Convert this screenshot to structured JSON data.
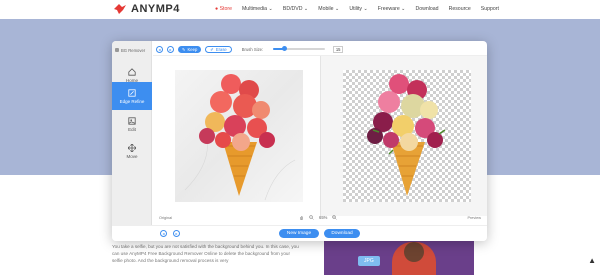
{
  "site": {
    "brand": "ANYMP4",
    "nav": [
      {
        "label": "Store",
        "hot": true
      },
      {
        "label": "Multimedia ⌄",
        "hot": false
      },
      {
        "label": "BD/DVD ⌄",
        "hot": false
      },
      {
        "label": "Mobile ⌄",
        "hot": false
      },
      {
        "label": "Utility ⌄",
        "hot": false
      },
      {
        "label": "Freeware ⌄",
        "hot": false
      },
      {
        "label": "Download",
        "hot": false
      },
      {
        "label": "Resource",
        "hot": false
      },
      {
        "label": "Support",
        "hot": false
      }
    ],
    "body_text": "You take a selfie, but you are not satisfied with the background behind you. In this case, you can use AnyMP4 Free Background Remover Online to delete the background from your selfie photo. And the background removal process is very",
    "image_badge": "JPG"
  },
  "editor": {
    "app_label": "BG Remover",
    "sidebar": [
      {
        "label": "Home",
        "icon": "home-icon",
        "active": false
      },
      {
        "label": "Edge Refine",
        "icon": "edge-refine-icon",
        "active": true
      },
      {
        "label": "Edit",
        "icon": "edit-icon",
        "active": false
      },
      {
        "label": "Move",
        "icon": "move-icon",
        "active": false
      }
    ],
    "toolbar": {
      "keep_label": "Keep",
      "erase_label": "Erase",
      "brush_label": "Brush Size:",
      "brush_value": "15",
      "brush_fraction": 0.2
    },
    "status": {
      "left_label": "Original",
      "right_label": "Preview",
      "zoom": "65%"
    },
    "footer": {
      "new_image": "New Image",
      "download": "Download"
    }
  },
  "colors": {
    "accent": "#3d8ef0",
    "banner": "#a8b5d6"
  }
}
